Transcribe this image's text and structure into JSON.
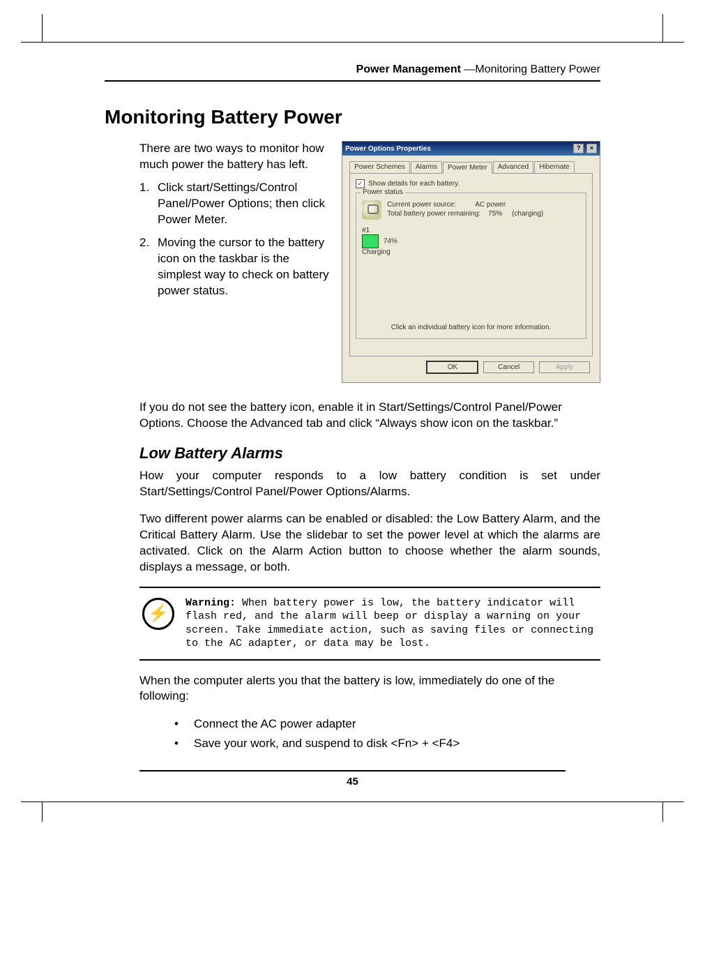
{
  "header": {
    "bold": "Power Management",
    "rest": " —Monitoring Battery Power"
  },
  "section_title": "Monitoring Battery Power",
  "intro": "There are two ways to monitor how much power the battery has left.",
  "list": [
    {
      "num": "1.",
      "text": "Click start/Settings/Control Panel/Power Options; then click Power Meter."
    },
    {
      "num": "2.",
      "text": "Moving the cursor to the battery icon on the taskbar is the simplest way to check on battery power status."
    }
  ],
  "dialog": {
    "title": "Power Options Properties",
    "tabs": [
      "Power Schemes",
      "Alarms",
      "Power Meter",
      "Advanced",
      "Hibernate"
    ],
    "active_tab": 2,
    "checkbox_label": "Show details for each battery.",
    "group_legend": "Power status",
    "src_label": "Current power source:",
    "src_value": "AC power",
    "rem_label": "Total battery power remaining:",
    "rem_value": "75%",
    "rem_state": "(charging)",
    "batt_num": "#1",
    "batt_pct": "74%",
    "batt_state": "Charging",
    "hint": "Click an individual battery icon for more information.",
    "ok": "OK",
    "cancel": "Cancel",
    "apply": "Apply"
  },
  "para_after": "If you do not see the battery icon, enable it in Start/Settings/Control Panel/Power Options. Choose the Advanced tab and click “Always show icon on the taskbar.”",
  "subhead": "Low Battery Alarms",
  "sub_p1": "How your computer responds to a low battery condition is set under Start/Settings/Control Panel/Power Options/Alarms.",
  "sub_p2": "Two different power alarms can be enabled or disabled: the Low Battery Alarm, and the Critical Battery Alarm. Use the slidebar to set the power level at which the alarms are activated. Click on the Alarm Action button to choose whether the alarm sounds, displays a message, or both.",
  "warning": {
    "label": "Warning:",
    "text": " When battery power is low, the battery indicator will flash red, and the alarm will beep or display a warning on your screen. Take immediate action, such as saving files or connecting to the AC adapter, or data may be lost."
  },
  "after_warn": "When the computer alerts you that the battery is low, immediately do one of the following:",
  "bullets": [
    "Connect the AC power adapter",
    "Save your work, and suspend to disk <Fn> + <F4>"
  ],
  "page_number": "45"
}
